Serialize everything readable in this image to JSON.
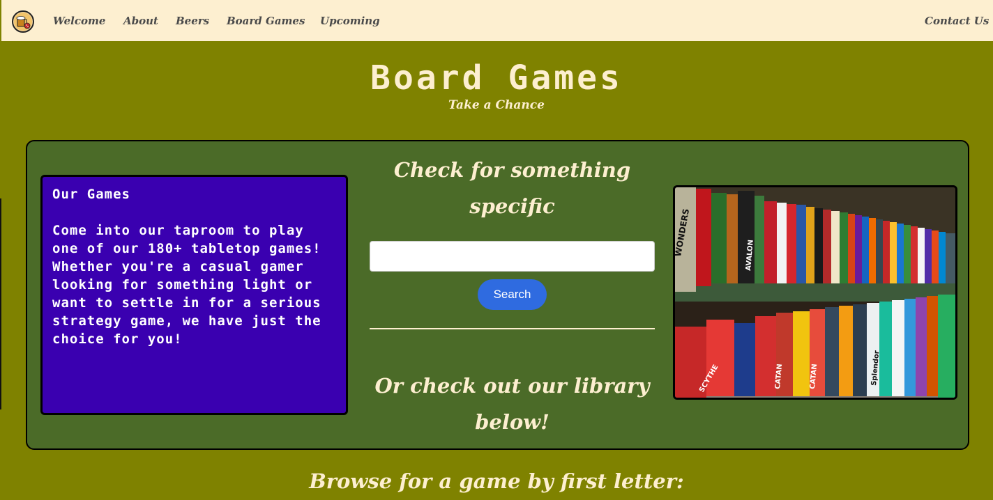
{
  "nav": {
    "items": [
      {
        "label": "Welcome"
      },
      {
        "label": "About"
      },
      {
        "label": "Beers"
      },
      {
        "label": "Board Games"
      },
      {
        "label": "Upcoming"
      }
    ],
    "contact": "Contact Us"
  },
  "header": {
    "title": "Board Games",
    "subtitle": "Take a Chance"
  },
  "info": {
    "title": "Our Games",
    "body": "Come into our taproom to play one of our 180+ tabletop games! Whether you're a casual gamer looking for something light or want to settle in for a serious strategy game, we have just the choice for you!"
  },
  "search": {
    "heading": "Check for something specific",
    "value": "",
    "placeholder": "",
    "button_label": "Search"
  },
  "library": {
    "heading": "Or check out our library below!"
  },
  "browse": {
    "heading": "Browse for a game by first letter:"
  },
  "photo": {
    "box_labels": [
      "WONDERS",
      "CATAN",
      "CATAN",
      "SCYTHE",
      "Splendor",
      "AVALON"
    ]
  },
  "colors": {
    "page_bg": "#7f8200",
    "nav_bg": "#fdefd0",
    "panel_bg": "#4b6b28",
    "info_bg": "#3a00b0",
    "cream_text": "#fdefd0",
    "button_bg": "#2f6be0"
  }
}
